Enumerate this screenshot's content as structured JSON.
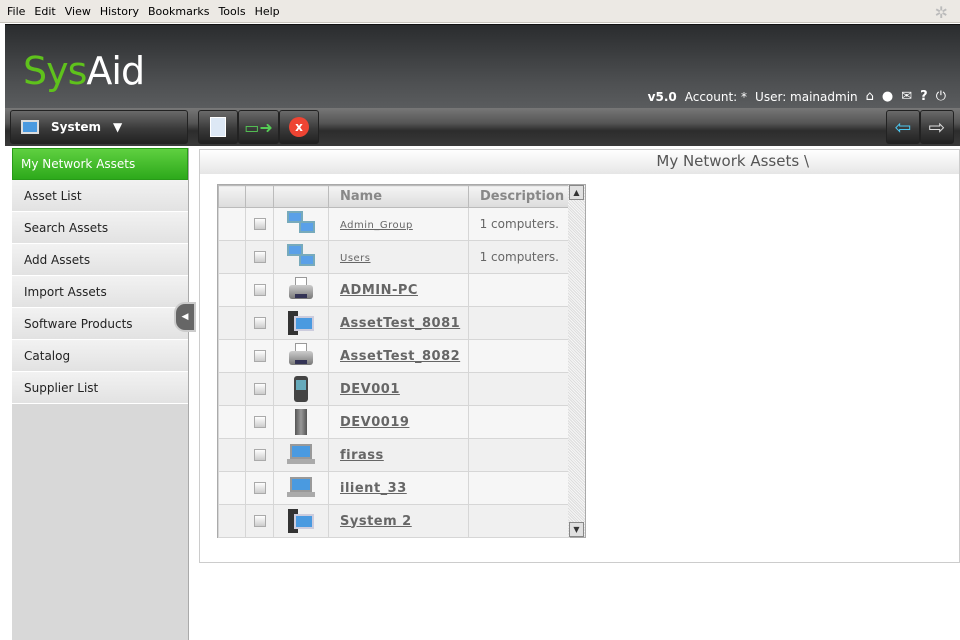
{
  "menu": [
    "File",
    "Edit",
    "View",
    "History",
    "Bookmarks",
    "Tools",
    "Help"
  ],
  "header": {
    "logo_left": "Sys",
    "logo_right": "Aid",
    "version": "v5.0",
    "account": "Account: *",
    "user": "User: mainadmin"
  },
  "toolbar": {
    "module": "System"
  },
  "sidebar": {
    "items": [
      "My Network Assets",
      "Asset List",
      "Search Assets",
      "Add Assets",
      "Import Assets",
      "Software Products",
      "Catalog",
      "Supplier List"
    ]
  },
  "main": {
    "title": "My Network Assets \\",
    "columns": [
      "Name",
      "Description"
    ],
    "rows": [
      {
        "name": "Admin_Group",
        "desc": "1 computers.",
        "icon": "group",
        "small": true
      },
      {
        "name": "Users",
        "desc": "1 computers.",
        "icon": "group",
        "small": true
      },
      {
        "name": "ADMIN-PC",
        "desc": "",
        "icon": "printer"
      },
      {
        "name": "AssetTest_8081",
        "desc": "",
        "icon": "computer"
      },
      {
        "name": "AssetTest_8082",
        "desc": "",
        "icon": "printer"
      },
      {
        "name": "DEV001",
        "desc": "",
        "icon": "pda"
      },
      {
        "name": "DEV0019",
        "desc": "",
        "icon": "server"
      },
      {
        "name": "firass",
        "desc": "",
        "icon": "laptop"
      },
      {
        "name": "ilient_33",
        "desc": "",
        "icon": "laptop"
      },
      {
        "name": "System 2",
        "desc": "",
        "icon": "computer"
      }
    ]
  }
}
